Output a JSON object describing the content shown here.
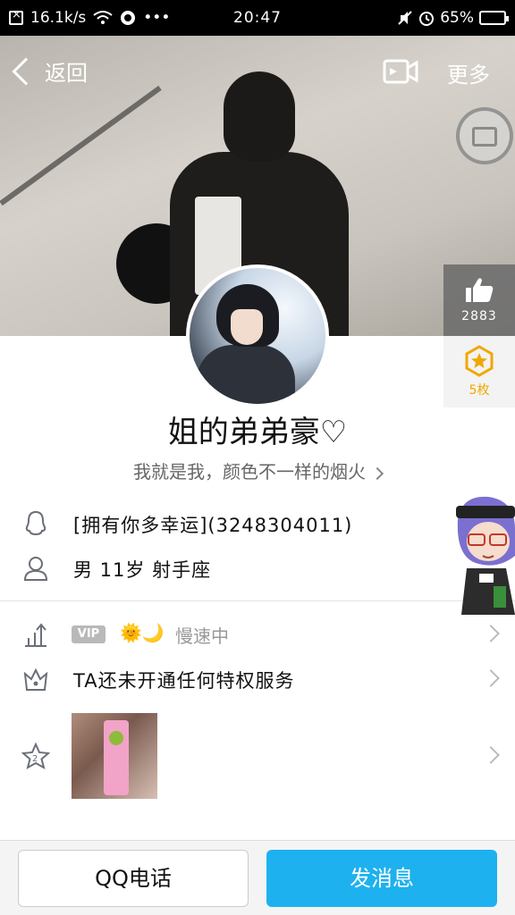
{
  "status_bar": {
    "speed": "16.1k/s",
    "time": "20:47",
    "battery": "65%",
    "battery_fraction": 0.65
  },
  "nav": {
    "back_label": "返回",
    "more_label": "更多"
  },
  "side_actions": {
    "like_count": "2883",
    "badge_label": "5枚"
  },
  "profile": {
    "nickname": "姐的弟弟豪♡",
    "signature": "我就是我，颜色不一样的烟火"
  },
  "info": {
    "group_line": "[拥有你多幸运](3248304011)",
    "personal_line": "男  11岁  射手座"
  },
  "vip": {
    "badge": "VIP",
    "emojis": "🌞🌙",
    "status": "慢速中",
    "privilege_text": "TA还未开通任何特权服务"
  },
  "buttons": {
    "call": "QQ电话",
    "message": "发消息"
  },
  "colors": {
    "primary_button": "#1eb1ef",
    "badge_gold": "#f0a800"
  }
}
